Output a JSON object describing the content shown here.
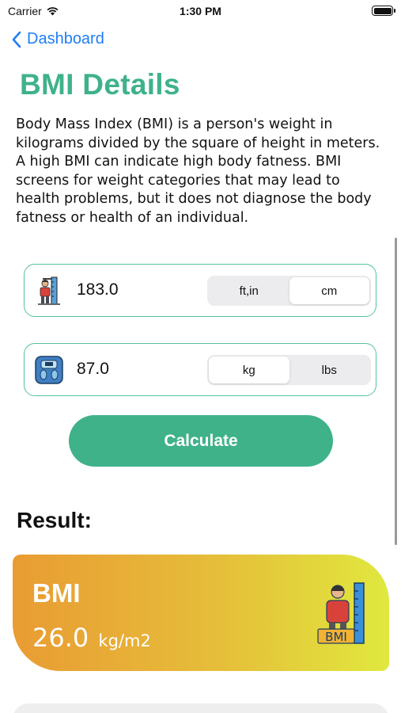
{
  "status_bar": {
    "carrier": "Carrier",
    "time": "1:30 PM",
    "wifi_icon": "wifi-icon",
    "battery_icon": "battery-icon"
  },
  "nav": {
    "back_label": "Dashboard",
    "back_icon": "chevron-left-icon"
  },
  "page": {
    "title": "BMI Details",
    "description": "Body Mass Index (BMI) is a person's weight in kilograms divided by the square of height in meters. A high BMI can indicate high body fatness. BMI screens for weight categories that may lead to health problems, but it does not diagnose the body fatness or health of an individual."
  },
  "height_input": {
    "icon": "height-measure-icon",
    "value": "183.0",
    "units": [
      "ft,in",
      "cm"
    ],
    "selected_unit": "cm"
  },
  "weight_input": {
    "icon": "weighing-scale-icon",
    "value": "87.0",
    "units": [
      "kg",
      "lbs"
    ],
    "selected_unit": "kg"
  },
  "calculate_label": "Calculate",
  "result": {
    "heading": "Result:",
    "bmi_label": "BMI",
    "bmi_value": "26.0",
    "bmi_unit": "kg/m2",
    "illustration_text": "BMI",
    "illustration_icon": "bmi-person-icon"
  },
  "colors": {
    "accent": "#3fb28a",
    "link": "#1f7ef5",
    "card_gradient_start": "#e99c33",
    "card_gradient_end": "#e0e83e"
  }
}
